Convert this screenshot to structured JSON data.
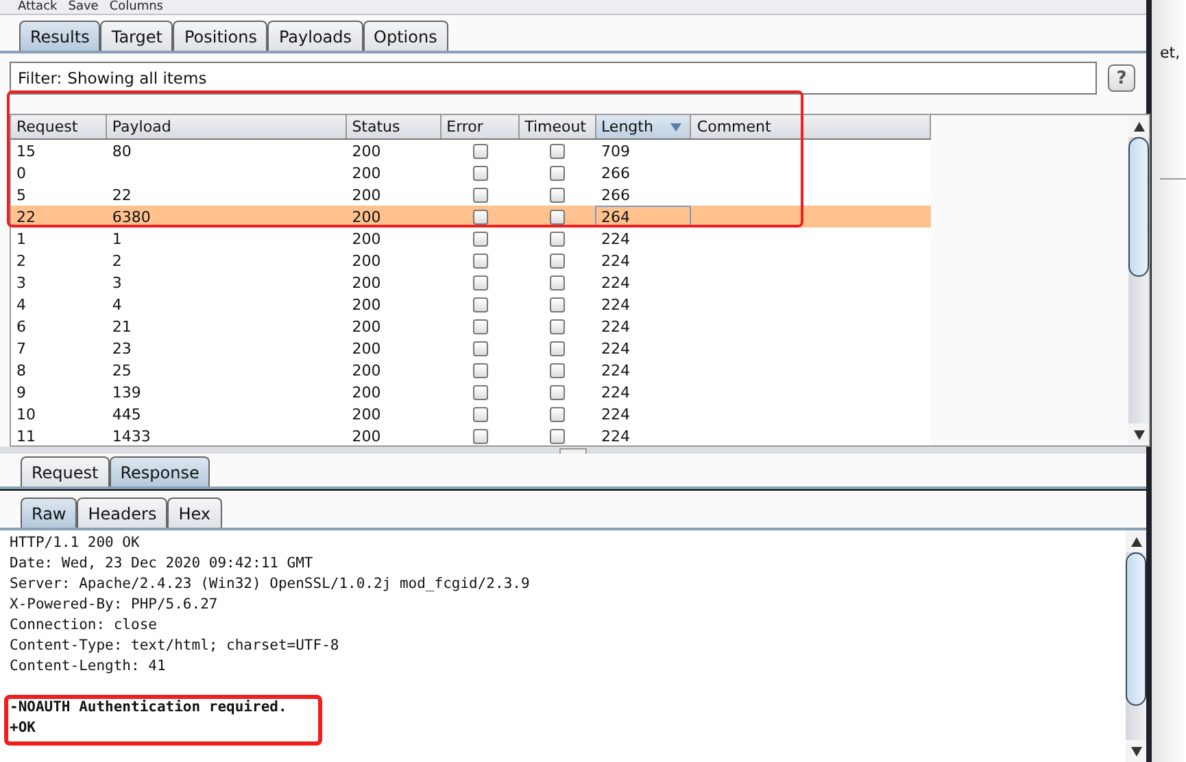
{
  "menu": [
    "Attack",
    "Save",
    "Columns"
  ],
  "tabs": [
    {
      "label": "Results",
      "selected": true
    },
    {
      "label": "Target",
      "selected": false
    },
    {
      "label": "Positions",
      "selected": false
    },
    {
      "label": "Payloads",
      "selected": false
    },
    {
      "label": "Options",
      "selected": false
    }
  ],
  "filter": {
    "label": "Filter:",
    "value": "Showing all items",
    "help": "?"
  },
  "table": {
    "columns": [
      {
        "label": "Request",
        "sorted": false
      },
      {
        "label": "Payload",
        "sorted": false
      },
      {
        "label": "Status",
        "sorted": false
      },
      {
        "label": "Error",
        "sorted": false
      },
      {
        "label": "Timeout",
        "sorted": false
      },
      {
        "label": "Length",
        "sorted": true
      },
      {
        "label": "Comment",
        "sorted": false
      }
    ],
    "rows": [
      {
        "request": "15",
        "payload": "80",
        "status": "200",
        "error": false,
        "timeout": false,
        "length": "709",
        "selected": false
      },
      {
        "request": "0",
        "payload": "",
        "status": "200",
        "error": false,
        "timeout": false,
        "length": "266",
        "selected": false
      },
      {
        "request": "5",
        "payload": "22",
        "status": "200",
        "error": false,
        "timeout": false,
        "length": "266",
        "selected": false
      },
      {
        "request": "22",
        "payload": "6380",
        "status": "200",
        "error": false,
        "timeout": false,
        "length": "264",
        "selected": true
      },
      {
        "request": "1",
        "payload": "1",
        "status": "200",
        "error": false,
        "timeout": false,
        "length": "224",
        "selected": false
      },
      {
        "request": "2",
        "payload": "2",
        "status": "200",
        "error": false,
        "timeout": false,
        "length": "224",
        "selected": false
      },
      {
        "request": "3",
        "payload": "3",
        "status": "200",
        "error": false,
        "timeout": false,
        "length": "224",
        "selected": false
      },
      {
        "request": "4",
        "payload": "4",
        "status": "200",
        "error": false,
        "timeout": false,
        "length": "224",
        "selected": false
      },
      {
        "request": "6",
        "payload": "21",
        "status": "200",
        "error": false,
        "timeout": false,
        "length": "224",
        "selected": false
      },
      {
        "request": "7",
        "payload": "23",
        "status": "200",
        "error": false,
        "timeout": false,
        "length": "224",
        "selected": false
      },
      {
        "request": "8",
        "payload": "25",
        "status": "200",
        "error": false,
        "timeout": false,
        "length": "224",
        "selected": false
      },
      {
        "request": "9",
        "payload": "139",
        "status": "200",
        "error": false,
        "timeout": false,
        "length": "224",
        "selected": false
      },
      {
        "request": "10",
        "payload": "445",
        "status": "200",
        "error": false,
        "timeout": false,
        "length": "224",
        "selected": false
      },
      {
        "request": "11",
        "payload": "1433",
        "status": "200",
        "error": false,
        "timeout": false,
        "length": "224",
        "selected": false
      }
    ]
  },
  "message_tabs": [
    {
      "label": "Request",
      "selected": false
    },
    {
      "label": "Response",
      "selected": true
    }
  ],
  "view_tabs": [
    {
      "label": "Raw",
      "selected": true
    },
    {
      "label": "Headers",
      "selected": false
    },
    {
      "label": "Hex",
      "selected": false
    }
  ],
  "response": {
    "headers": [
      "HTTP/1.1 200 OK",
      "Date: Wed, 23 Dec 2020 09:42:11 GMT",
      "Server: Apache/2.4.23 (Win32) OpenSSL/1.0.2j mod_fcgid/2.3.9",
      "X-Powered-By: PHP/5.6.27",
      "Connection: close",
      "Content-Type: text/html; charset=UTF-8",
      "Content-Length: 41"
    ],
    "body": [
      "-NOAUTH Authentication required.",
      "+OK"
    ]
  },
  "annotations": {
    "table_highlighted": true,
    "response_highlighted": true
  },
  "background_text": "et,"
}
